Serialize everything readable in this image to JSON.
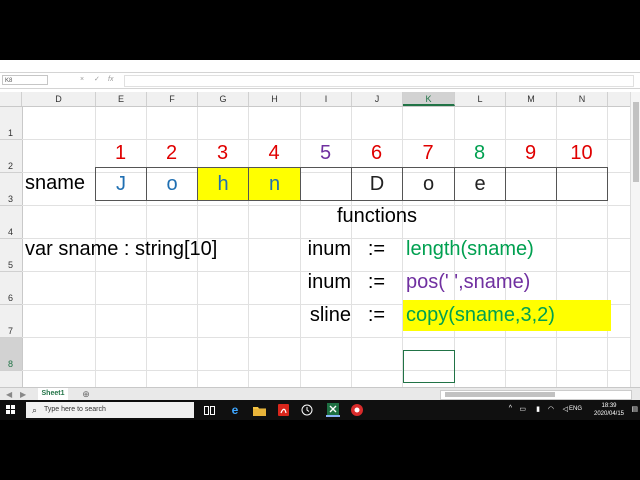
{
  "formula_bar": {
    "namebox": "K8",
    "cancel_icon": "×",
    "enter_icon": "✓",
    "fx": "fx",
    "value": ""
  },
  "columns": [
    {
      "id": "D",
      "label": "D"
    },
    {
      "id": "E",
      "label": "E"
    },
    {
      "id": "F",
      "label": "F"
    },
    {
      "id": "G",
      "label": "G"
    },
    {
      "id": "H",
      "label": "H"
    },
    {
      "id": "I",
      "label": "I"
    },
    {
      "id": "J",
      "label": "J"
    },
    {
      "id": "K",
      "label": "K"
    },
    {
      "id": "L",
      "label": "L"
    },
    {
      "id": "M",
      "label": "M"
    },
    {
      "id": "N",
      "label": "N"
    }
  ],
  "rows": [
    "1",
    "2",
    "3",
    "4",
    "5",
    "6",
    "7",
    "8"
  ],
  "active_cell": "K8",
  "cells": {
    "index_row": [
      {
        "label": "1",
        "color": "#e00000"
      },
      {
        "label": "2",
        "color": "#e00000"
      },
      {
        "label": "3",
        "color": "#e00000"
      },
      {
        "label": "4",
        "color": "#e00000"
      },
      {
        "label": "5",
        "color": "#7030a0"
      },
      {
        "label": "6",
        "color": "#e00000"
      },
      {
        "label": "7",
        "color": "#e00000"
      },
      {
        "label": "8",
        "color": "#00a050"
      },
      {
        "label": "9",
        "color": "#e00000"
      },
      {
        "label": "10",
        "color": "#e00000"
      }
    ],
    "sname_label": "sname",
    "sname_chars": [
      {
        "label": "J",
        "color": "#1f6fb2",
        "bg": ""
      },
      {
        "label": "o",
        "color": "#1f6fb2",
        "bg": ""
      },
      {
        "label": "h",
        "color": "#1f6fb2",
        "bg": "#ffff00"
      },
      {
        "label": "n",
        "color": "#1f6fb2",
        "bg": "#ffff00"
      },
      {
        "label": "",
        "color": "#000",
        "bg": ""
      },
      {
        "label": "D",
        "color": "#222",
        "bg": ""
      },
      {
        "label": "o",
        "color": "#222",
        "bg": ""
      },
      {
        "label": "e",
        "color": "#222",
        "bg": ""
      },
      {
        "label": "",
        "color": "#000",
        "bg": ""
      },
      {
        "label": "",
        "color": "#000",
        "bg": ""
      }
    ],
    "functions_header": "functions",
    "declaration": "var sname : string[10]",
    "statements": [
      {
        "var": "inum",
        "op": ":=",
        "expr": "length(sname)",
        "color": "#00a050",
        "bg": ""
      },
      {
        "var": "inum",
        "op": ":=",
        "expr": "pos(' ',sname)",
        "color": "#7030a0",
        "bg": ""
      },
      {
        "var": "sline",
        "op": ":=",
        "expr": "copy(sname,3,2)",
        "color": "#00a050",
        "bg": "#ffff00"
      }
    ]
  },
  "sheet_tab": "Sheet1",
  "taskbar": {
    "search_placeholder": "Type here to search",
    "language": "ENG",
    "time": "18:39",
    "date": "2020/04/15"
  }
}
